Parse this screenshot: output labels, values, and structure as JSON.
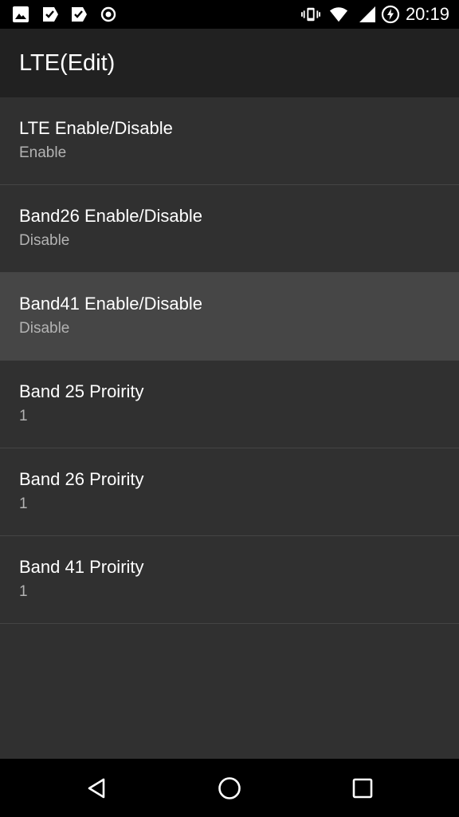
{
  "status_bar": {
    "time": "20:19",
    "left_icons": [
      "image-icon",
      "check-flag-icon",
      "check-flag-icon",
      "target-icon"
    ],
    "right_icons": [
      "vibrate-icon",
      "wifi-icon",
      "battery-saver-icon",
      "signal-icon"
    ]
  },
  "app_bar": {
    "title": "LTE(Edit)"
  },
  "preferences": [
    {
      "title": "LTE Enable/Disable",
      "summary": "Enable"
    },
    {
      "title": "Band26 Enable/Disable",
      "summary": "Disable"
    },
    {
      "title": "Band41 Enable/Disable",
      "summary": "Disable"
    },
    {
      "title": "Band 25 Proirity",
      "summary": "1"
    },
    {
      "title": "Band 26 Proirity",
      "summary": "1"
    },
    {
      "title": "Band 41 Proirity",
      "summary": "1"
    }
  ],
  "nav_bar": {
    "icons": [
      "back-icon",
      "home-icon",
      "recents-icon"
    ]
  },
  "colors": {
    "background": "#303030",
    "app_bar": "#212121",
    "highlight": "#464646",
    "summary_text": "#b3b3b3"
  }
}
